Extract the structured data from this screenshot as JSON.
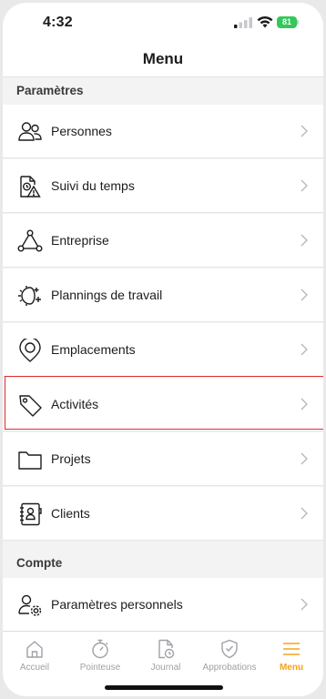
{
  "status": {
    "time": "4:32",
    "battery": "81"
  },
  "header": {
    "title": "Menu"
  },
  "sections": {
    "settings": "Paramètres",
    "account": "Compte"
  },
  "menu": {
    "items": [
      {
        "label": "Personnes",
        "icon": "people-icon"
      },
      {
        "label": "Suivi du temps",
        "icon": "time-tracking-icon"
      },
      {
        "label": "Entreprise",
        "icon": "company-icon"
      },
      {
        "label": "Plannings de travail",
        "icon": "work-schedule-icon"
      },
      {
        "label": "Emplacements",
        "icon": "location-pin-icon"
      },
      {
        "label": "Activités",
        "icon": "tag-icon"
      },
      {
        "label": "Projets",
        "icon": "folder-icon"
      },
      {
        "label": "Clients",
        "icon": "contacts-book-icon"
      }
    ],
    "account_items": [
      {
        "label": "Paramètres personnels",
        "icon": "user-settings-icon"
      }
    ]
  },
  "tabbar": {
    "tabs": [
      {
        "label": "Accueil",
        "icon": "home-icon",
        "active": false
      },
      {
        "label": "Pointeuse",
        "icon": "stopwatch-icon",
        "active": false
      },
      {
        "label": "Journal",
        "icon": "journal-icon",
        "active": false
      },
      {
        "label": "Approbations",
        "icon": "shield-check-icon",
        "active": false
      },
      {
        "label": "Menu",
        "icon": "menu-icon",
        "active": true
      }
    ]
  },
  "colors": {
    "accent": "#f5a31a",
    "highlight": "#e02b2b",
    "battery": "#34c759"
  }
}
